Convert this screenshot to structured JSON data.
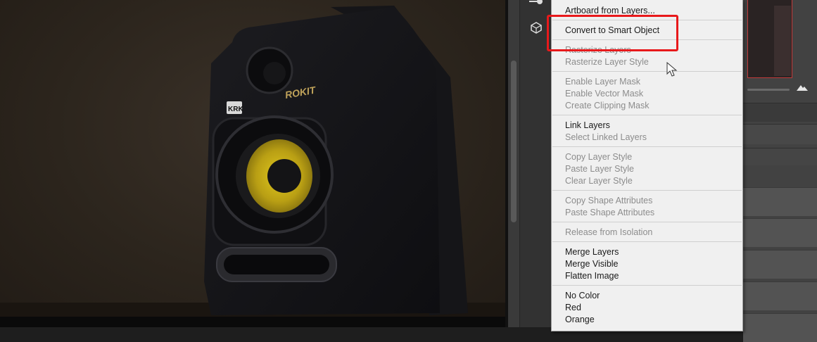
{
  "canvas": {
    "speaker_brand": "KRK",
    "speaker_model": "ROKIT"
  },
  "context_menu": {
    "items": [
      {
        "label": "Artboard from Layers...",
        "enabled": true,
        "highlighted": false
      },
      {
        "label": "Convert to Smart Object",
        "enabled": true,
        "highlighted": true
      },
      {
        "label": "Rasterize Layers",
        "enabled": false
      },
      {
        "label": "Rasterize Layer Style",
        "enabled": false
      },
      {
        "label": "Enable Layer Mask",
        "enabled": false
      },
      {
        "label": "Enable Vector Mask",
        "enabled": false
      },
      {
        "label": "Create Clipping Mask",
        "enabled": false
      },
      {
        "label": "Link Layers",
        "enabled": true
      },
      {
        "label": "Select Linked Layers",
        "enabled": false
      },
      {
        "label": "Copy Layer Style",
        "enabled": false
      },
      {
        "label": "Paste Layer Style",
        "enabled": false
      },
      {
        "label": "Clear Layer Style",
        "enabled": false
      },
      {
        "label": "Copy Shape Attributes",
        "enabled": false
      },
      {
        "label": "Paste Shape Attributes",
        "enabled": false
      },
      {
        "label": "Release from Isolation",
        "enabled": false
      },
      {
        "label": "Merge Layers",
        "enabled": true
      },
      {
        "label": "Merge Visible",
        "enabled": true
      },
      {
        "label": "Flatten Image",
        "enabled": true
      },
      {
        "label": "No Color",
        "enabled": true
      },
      {
        "label": "Red",
        "enabled": true
      },
      {
        "label": "Orange",
        "enabled": true
      }
    ]
  },
  "colors": {
    "highlight_box": "#e8191b",
    "menu_bg": "#f0f0f0",
    "disabled_text": "#8c8c8c",
    "speaker_cone": "#c9b21a"
  },
  "icons": {
    "tool_1": "brush-settings-icon",
    "tool_2": "3d-cube-icon",
    "navigator_zoom": "mountain-icon",
    "cursor": "mouse-pointer-icon"
  }
}
